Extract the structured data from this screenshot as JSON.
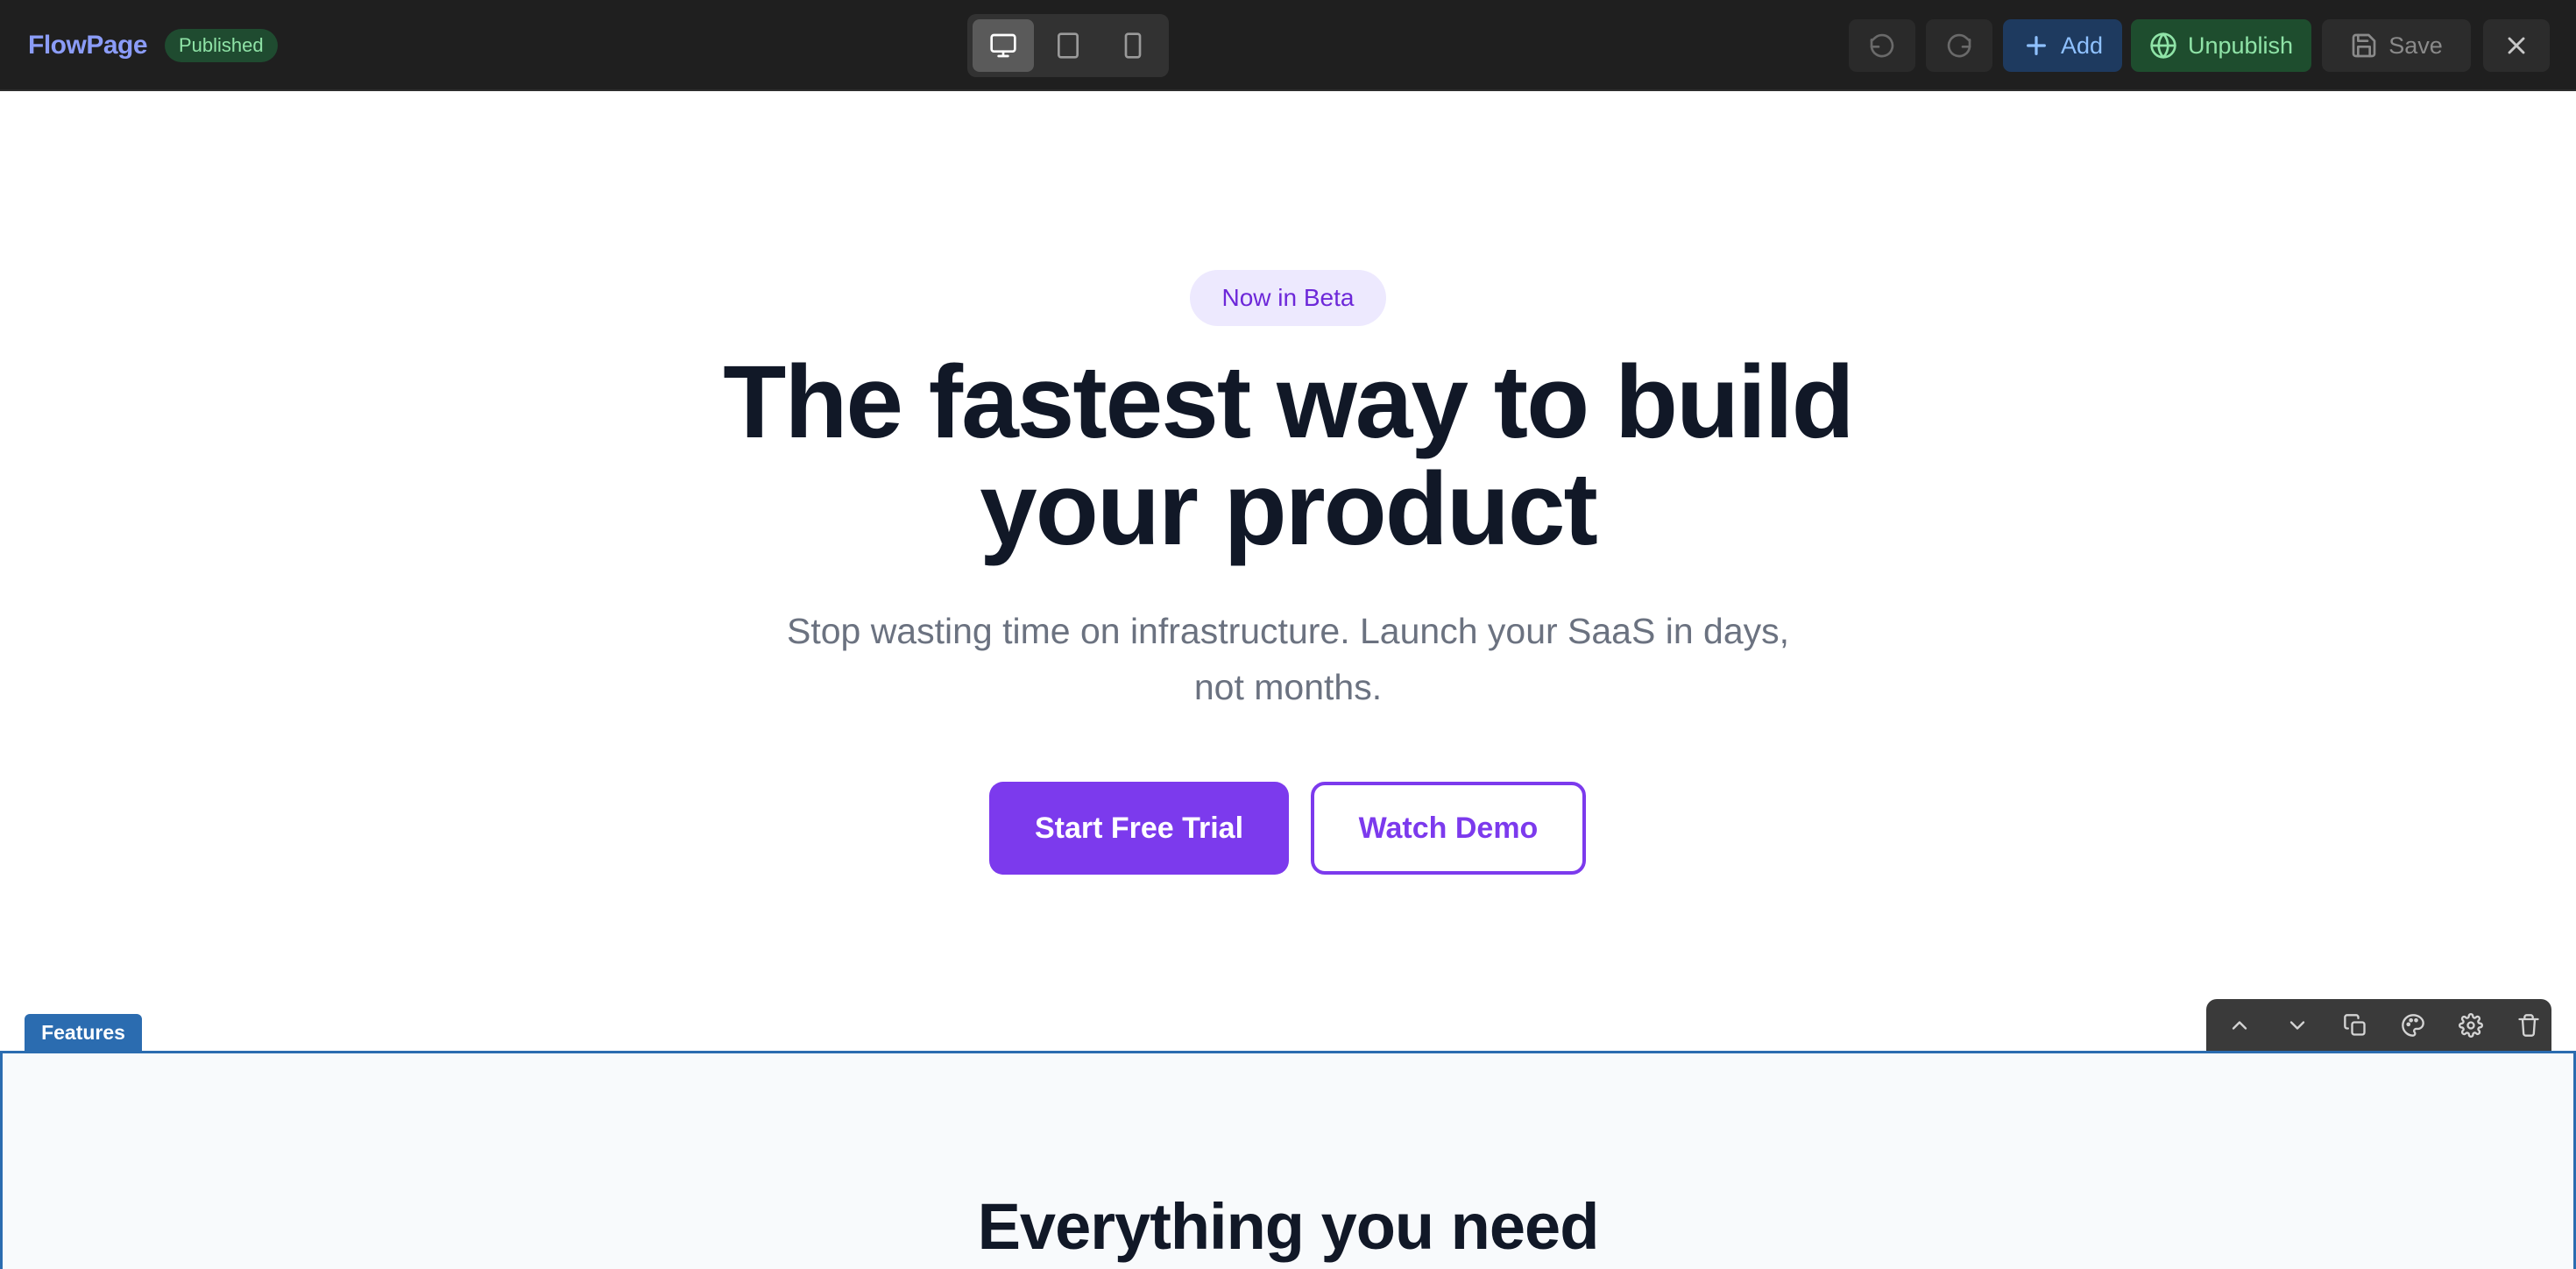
{
  "app": {
    "brand": "FlowPage",
    "status": "Published"
  },
  "device_toggle": {
    "active": "desktop",
    "options": [
      "desktop-icon",
      "tablet-icon",
      "mobile-icon"
    ]
  },
  "toolbar": {
    "undo_icon": "undo-icon",
    "redo_icon": "redo-icon",
    "add_label": "Add",
    "unpublish_label": "Unpublish",
    "save_label": "Save",
    "close_icon": "close-icon"
  },
  "hero": {
    "badge": "Now in Beta",
    "title_line1": "The fastest way to build",
    "title_line2": "your product",
    "subtitle_line1": "Stop wasting time on infrastructure. Launch your SaaS in days,",
    "subtitle_line2": "not months.",
    "primary_cta": "Start Free Trial",
    "secondary_cta": "Watch Demo"
  },
  "selected_section": {
    "tag": "Features",
    "actions": [
      "move-up-icon",
      "move-down-icon",
      "duplicate-icon",
      "palette-icon",
      "settings-icon",
      "trash-icon"
    ]
  },
  "features": {
    "title": "Everything you need"
  },
  "colors": {
    "accent": "#7c3aed",
    "selection": "#2b6cb0",
    "topbar": "#1f1f1f"
  }
}
